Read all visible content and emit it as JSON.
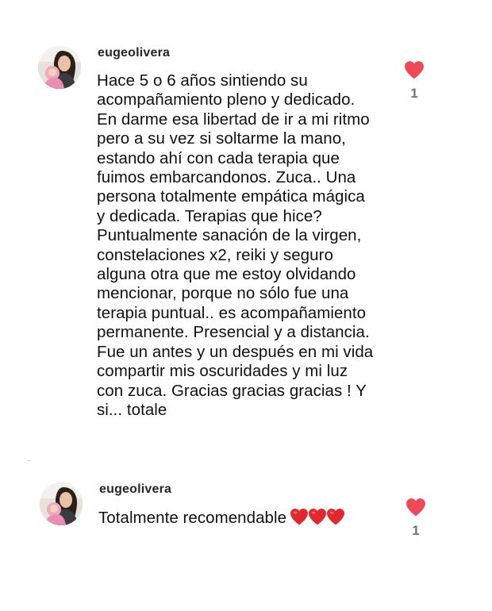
{
  "comments": [
    {
      "username": "eugeolivera",
      "avatar_icon": "profile-photo",
      "text": "Hace 5 o 6 años sintiendo su\nacompañamiento pleno y dedicado.\nEn darme esa libertad de ir a mi ritmo\npero a su vez si soltarme la mano,\nestando ahí con cada terapia que\nfuimos embarcandonos. Zuca.. Una\npersona totalmente empática mágica\ny dedicada. Terapias que hice?\nPuntualmente sanación de la virgen,\nconstelaciones x2, reiki y seguro\nalguna otra que me estoy olvidando\nmencionar, porque no sólo fue una\nterapia puntual.. es acompañamiento\npermanente. Presencial y a distancia.\nFue un antes y un después en mi vida\ncompartir mis oscuridades y mi luz\ncon zuca. Gracias gracias gracias ! Y\nsi... totale",
      "like_icon": "heart-filled-icon",
      "like_count": "1"
    },
    {
      "username": "eugeolivera",
      "avatar_icon": "profile-photo",
      "text": "Totalmente recomendable",
      "emoji": "❤️❤️❤️",
      "like_icon": "heart-filled-icon",
      "like_count": "1"
    }
  ],
  "colors": {
    "heart": "#ed4956",
    "username": "#262626",
    "text": "#111111",
    "count": "#737373"
  }
}
